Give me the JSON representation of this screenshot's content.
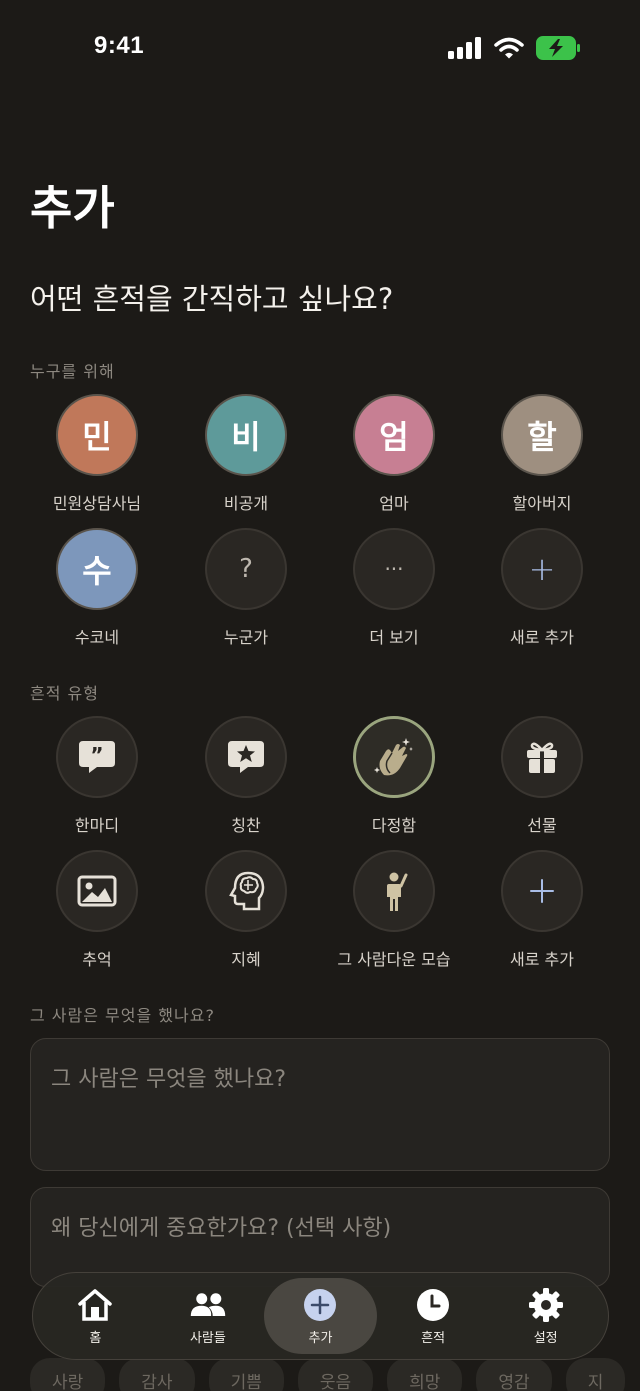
{
  "status": {
    "time": "9:41"
  },
  "page": {
    "title": "추가",
    "question": "어떤 흔적을 간직하고 싶나요?"
  },
  "people_section": {
    "label": "누구를 위해",
    "items": [
      {
        "initial": "민",
        "name": "민원상담사님",
        "color": "#c0785a"
      },
      {
        "initial": "비",
        "name": "비공개",
        "color": "#5e9a9a"
      },
      {
        "initial": "엄",
        "name": "엄마",
        "color": "#c77f93"
      },
      {
        "initial": "할",
        "name": "할아버지",
        "color": "#9e8f80"
      },
      {
        "initial": "수",
        "name": "수코네",
        "color": "#7d97bb"
      },
      {
        "initial": "?",
        "name": "누군가"
      },
      {
        "initial": "···",
        "name": "더 보기"
      },
      {
        "initial": "+",
        "name": "새로 추가"
      }
    ]
  },
  "type_section": {
    "label": "흔적 유형",
    "items": [
      {
        "name": "한마디",
        "icon": "quote-bubble-icon"
      },
      {
        "name": "칭찬",
        "icon": "star-bubble-icon"
      },
      {
        "name": "다정함",
        "icon": "clapping-hands-icon",
        "selected": true
      },
      {
        "name": "선물",
        "icon": "gift-icon"
      },
      {
        "name": "추억",
        "icon": "photo-icon"
      },
      {
        "name": "지혜",
        "icon": "brain-head-icon"
      },
      {
        "name": "그 사람다운 모습",
        "icon": "person-waving-icon"
      },
      {
        "name": "새로 추가",
        "icon": "plus-icon"
      }
    ]
  },
  "what_section": {
    "label": "그 사람은 무엇을 했나요?",
    "placeholder": "그 사람은 무엇을 했나요?"
  },
  "why_field": {
    "placeholder": "왜 당신에게 중요한가요? (선택 사항)"
  },
  "emotion_chips": [
    "사랑",
    "감사",
    "기쁨",
    "웃음",
    "희망",
    "영감",
    "지"
  ],
  "tabbar": {
    "home": "홈",
    "people": "사람들",
    "add": "추가",
    "traces": "흔적",
    "settings": "설정"
  },
  "colors": {
    "accent": "#9aa57e",
    "background": "#1c1a17",
    "tab_add": "#c6d2ee"
  }
}
